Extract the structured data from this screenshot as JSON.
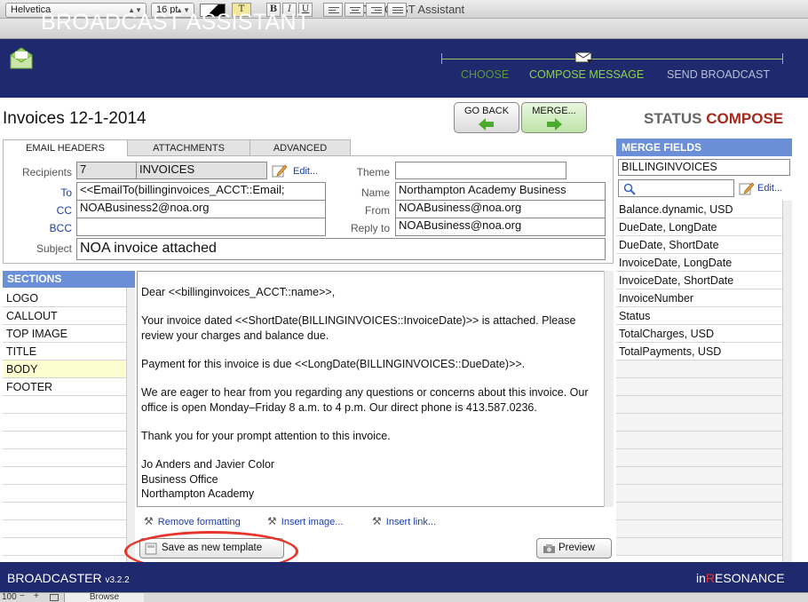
{
  "window": {
    "title": "BROADCAST Assistant"
  },
  "format_bar": {
    "font": "Helvetica",
    "size": "16 pt",
    "text_tool": "T",
    "bold": "B",
    "italic": "I",
    "underline": "U"
  },
  "header": {
    "app_title": "BROADCAST ASSISTANT",
    "steps": [
      "CHOOSE",
      "COMPOSE MESSAGE",
      "SEND BROADCAST"
    ]
  },
  "record": {
    "title": "Invoices 12-1-2014"
  },
  "nav": {
    "go_back": "GO BACK",
    "merge": "MERGE..."
  },
  "status": {
    "label": "STATUS",
    "value": "COMPOSE"
  },
  "tabs": [
    "EMAIL HEADERS",
    "ATTACHMENTS",
    "ADVANCED"
  ],
  "email_headers": {
    "recipients_label": "Recipients",
    "recipients_count": "7",
    "recipients_name": "INVOICES",
    "edit": "Edit...",
    "to_label": "To",
    "to_value": "<<EmailTo(billinginvoices_ACCT::Email;",
    "cc_label": "CC",
    "cc_value": "NOABusiness2@noa.org",
    "bcc_label": "BCC",
    "bcc_value": "",
    "subject_label": "Subject",
    "subject_value": "NOA invoice attached",
    "theme_label": "Theme",
    "theme_value": "",
    "name_label": "Name",
    "name_value": "Northampton Academy Business",
    "from_label": "From",
    "from_value": "NOABusiness@noa.org",
    "reply_label": "Reply to",
    "reply_value": "NOABusiness@noa.org"
  },
  "sections": {
    "title": "SECTIONS",
    "items": [
      "LOGO",
      "CALLOUT",
      "TOP IMAGE",
      "TITLE",
      "BODY",
      "FOOTER"
    ]
  },
  "body": {
    "paragraphs": [
      "Dear <<billinginvoices_ACCT::name>>,",
      "Your invoice dated <<ShortDate(BILLINGINVOICES::InvoiceDate)>> is attached. Please review your charges and balance due.",
      "Payment for this invoice is due <<LongDate(BILLINGINVOICES::DueDate)>>.",
      "We are eager to hear from you regarding any questions or concerns about this invoice. Our office is open Monday–Friday 8 a.m. to 4 p.m. Our direct phone is 413.587.0236.",
      "Thank you for your prompt attention to this invoice."
    ],
    "signature": [
      "Jo Anders and Javier Color",
      "Business Office",
      "Northampton Academy"
    ]
  },
  "editor_tools": {
    "remove": "Remove formatting",
    "image": "Insert image...",
    "link": "Insert link..."
  },
  "buttons": {
    "save_template": "Save as new template",
    "preview": "Preview"
  },
  "merge_fields": {
    "title": "MERGE FIELDS",
    "table": "BILLINGINVOICES",
    "edit": "Edit...",
    "items": [
      "Balance.dynamic, USD",
      "DueDate, LongDate",
      "DueDate, ShortDate",
      "InvoiceDate, LongDate",
      "InvoiceDate, ShortDate",
      "InvoiceNumber",
      "Status",
      "TotalCharges, USD",
      "TotalPayments, USD"
    ]
  },
  "footer": {
    "left": "BROADCASTER",
    "version": "v3.2.2",
    "right_a": "in",
    "right_b": "R",
    "right_c": "ESONANCE"
  },
  "statusbar": {
    "zoom": "100",
    "mode": "Browse"
  },
  "colors": {
    "header": "#1f2a6e",
    "accent": "#6b8fd6",
    "step_done": "#7dbb3a",
    "status": "#a5291c",
    "highlight": "#e8342a"
  }
}
